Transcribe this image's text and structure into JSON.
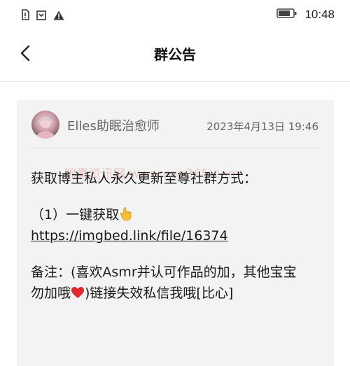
{
  "statusbar": {
    "time": "10:48",
    "icons": [
      "sim-alert-icon",
      "download-icon",
      "warning-icon",
      "battery-icon"
    ]
  },
  "header": {
    "title": "群公告"
  },
  "announcement": {
    "author": "Elles助眠治愈师",
    "timestamp": "2023年4月13日 19:46",
    "watermark": "锦囊资讯网 www.nsq365.com",
    "line1": "获取博主私人永久更新至尊社群方式：",
    "item_label": "（1）一键获取",
    "item_emoji": "backhand-index-pointing-down-icon",
    "link": "https://imgbed.link/file/16374",
    "note_line1": "备注：(喜欢Asmr并认可作品的加，其他宝宝",
    "note_line2_a": "勿加哦",
    "note_line2_emoji": "red-heart-icon",
    "note_line2_b": ")链接失效私信我哦[比心]"
  },
  "colors": {
    "card_background": "#f3f3f3",
    "text_primary": "#1a1a1a",
    "text_secondary": "#666666",
    "watermark": "#e4a3a3",
    "heart": "#e0282e",
    "hand": "#f7c23a"
  }
}
